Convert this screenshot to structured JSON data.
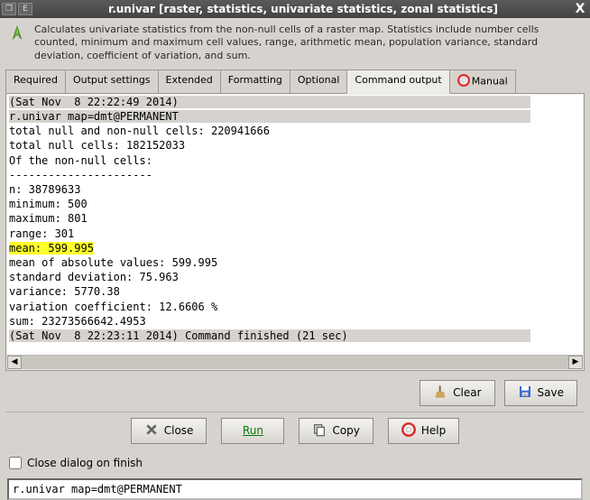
{
  "titlebar": {
    "minimize": "❐",
    "maximize": "E",
    "title": "r.univar [raster, statistics, univariate statistics, zonal statistics]",
    "close": "X"
  },
  "description": "Calculates univariate statistics from the non-null cells of a raster map. Statistics include number cells counted, minimum and maximum cell values, range, arithmetic mean, population variance, standard deviation, coefficient of variation, and sum.",
  "tabs": {
    "required": "Required",
    "output_settings": "Output settings",
    "extended": "Extended",
    "formatting": "Formatting",
    "optional": "Optional",
    "command_output": "Command output",
    "manual": "Manual"
  },
  "output": {
    "l01": "(Sat Nov  8 22:22:49 2014)                                                      ",
    "l02": "r.univar map=dmt@PERMANENT                                                      ",
    "l03": "total null and non-null cells: 220941666",
    "l04": "total null cells: 182152033",
    "l05": "Of the non-null cells:",
    "l06": "----------------------",
    "l07": "n: 38789633",
    "l08": "minimum: 500",
    "l09": "maximum: 801",
    "l10": "range: 301",
    "l11": "mean: 599.995",
    "l12": "mean of absolute values: 599.995",
    "l13": "standard deviation: 75.963",
    "l14": "variance: 5770.38",
    "l15": "variation coefficient: 12.6606 %",
    "l16": "sum: 23273566642.4953",
    "l17": "(Sat Nov  8 22:23:11 2014) Command finished (21 sec)                            "
  },
  "buttons": {
    "clear": "Clear",
    "save": "Save",
    "close": "Close",
    "run": "Run",
    "copy": "Copy",
    "help": "Help"
  },
  "close_dialog_label": "Close dialog on finish",
  "command_line": "r.univar map=dmt@PERMANENT"
}
